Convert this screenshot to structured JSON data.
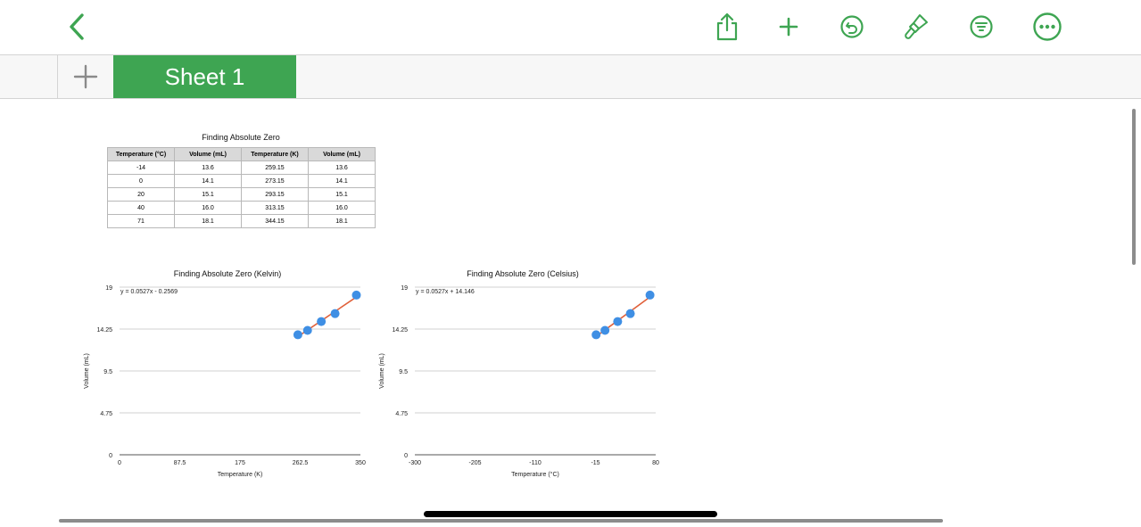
{
  "toolbar": {
    "icons": [
      "back-chevron-icon",
      "share-icon",
      "add-icon",
      "undo-icon",
      "format-brush-icon",
      "organize-icon",
      "more-icon"
    ],
    "accent": "#3ea552",
    "icon_color": "#3ea552"
  },
  "sheets": {
    "active": "Sheet 1"
  },
  "table": {
    "title": "Finding Absolute Zero",
    "headers": [
      "Temperature (°C)",
      "Volume (mL)",
      "Temperature (K)",
      "Volume (mL)"
    ],
    "rows": [
      [
        "-14",
        "13.6",
        "259.15",
        "13.6"
      ],
      [
        "0",
        "14.1",
        "273.15",
        "14.1"
      ],
      [
        "20",
        "15.1",
        "293.15",
        "15.1"
      ],
      [
        "40",
        "16.0",
        "313.15",
        "16.0"
      ],
      [
        "71",
        "18.1",
        "344.15",
        "18.1"
      ]
    ]
  },
  "chart_data": [
    {
      "type": "scatter",
      "title": "Finding Absolute Zero (Kelvin)",
      "xlabel": "Temperature (K)",
      "ylabel": "Volume (mL)",
      "xlim": [
        0,
        350
      ],
      "ylim": [
        0,
        19
      ],
      "xticks": [
        "0",
        "87.5",
        "175",
        "262.5",
        "350"
      ],
      "yticks": [
        "0",
        "4.75",
        "9.5",
        "14.25",
        "19"
      ],
      "x": [
        259.15,
        273.15,
        293.15,
        313.15,
        344.15
      ],
      "y": [
        13.6,
        14.1,
        15.1,
        16.0,
        18.1
      ],
      "trendline": "y = 0.0527x - 0.2569",
      "trend_slope": 0.0527,
      "trend_intercept": -0.2569,
      "point_color": "#3f8fe4",
      "line_color": "#e0603a",
      "grid": true
    },
    {
      "type": "scatter",
      "title": "Finding Absolute Zero (Celsius)",
      "xlabel": "Temperature (°C)",
      "ylabel": "Volume (mL)",
      "xlim": [
        -300,
        80
      ],
      "ylim": [
        0,
        19
      ],
      "xticks": [
        "-300",
        "-205",
        "-110",
        "-15",
        "80"
      ],
      "yticks": [
        "0",
        "4.75",
        "9.5",
        "14.25",
        "19"
      ],
      "x": [
        -14,
        0,
        20,
        40,
        71
      ],
      "y": [
        13.6,
        14.1,
        15.1,
        16.0,
        18.1
      ],
      "trendline": "y = 0.0527x + 14.146",
      "trend_slope": 0.0527,
      "trend_intercept": 14.146,
      "point_color": "#3f8fe4",
      "line_color": "#e0603a",
      "grid": true
    }
  ]
}
